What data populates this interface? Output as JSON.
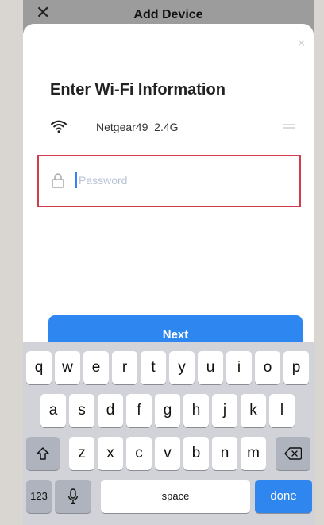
{
  "header": {
    "close_icon": "close-icon",
    "title": "Add Device"
  },
  "sheet": {
    "dismiss_icon": "close-icon",
    "heading": "Enter Wi-Fi Information",
    "wifi": {
      "icon": "wifi-icon",
      "ssid": "Netgear49_2.4G",
      "switch_icon": "switch-network-icon"
    },
    "password": {
      "icon": "lock-icon",
      "placeholder": "Password",
      "value": ""
    }
  },
  "next_button": {
    "label": "Next"
  },
  "colors": {
    "primary": "#2e86f0",
    "highlight_border": "#d33b4a"
  },
  "keyboard": {
    "row1": [
      "q",
      "w",
      "e",
      "r",
      "t",
      "y",
      "u",
      "i",
      "o",
      "p"
    ],
    "row2": [
      "a",
      "s",
      "d",
      "f",
      "g",
      "h",
      "j",
      "k",
      "l"
    ],
    "row3": [
      "z",
      "x",
      "c",
      "v",
      "b",
      "n",
      "m"
    ],
    "shift_icon": "shift-icon",
    "backspace_icon": "backspace-icon",
    "numbers_label": "123",
    "mic_icon": "microphone-icon",
    "space_label": "space",
    "done_label": "done"
  }
}
